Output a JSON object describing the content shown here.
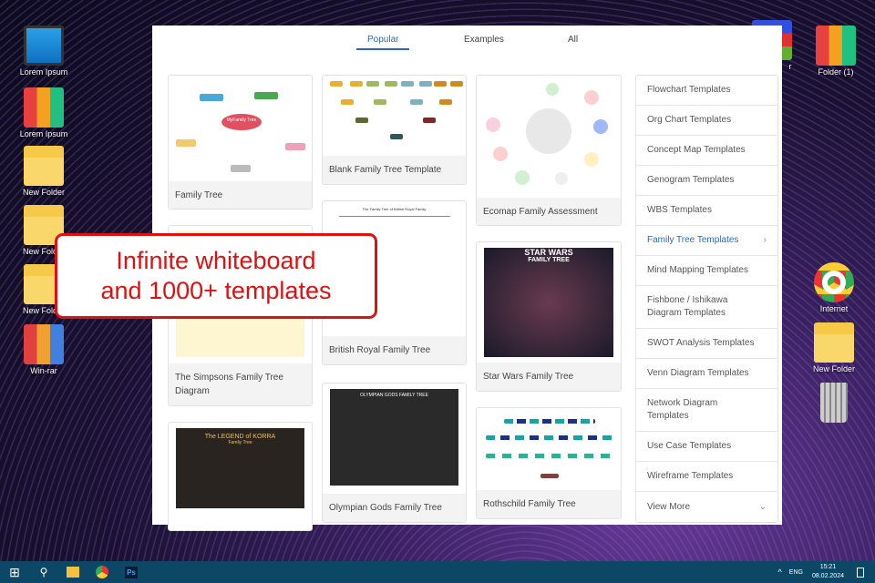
{
  "desktop": {
    "left_icons": [
      "Lorem Ipsum",
      "Lorem Ipsum",
      "New Folder",
      "New Folder",
      "New Folder",
      "Win-rar"
    ],
    "right_icons": [
      "Folder (1)",
      "Internet",
      "New Folder"
    ],
    "partial_label": "r"
  },
  "tabs": [
    {
      "label": "Popular",
      "active": true
    },
    {
      "label": "Examples"
    },
    {
      "label": "All"
    }
  ],
  "cards": {
    "family_tree": "Family Tree",
    "simpsons": "The Simpsons Family Tree Diagram",
    "blank": "Blank Family Tree Template",
    "british": "British Royal Family Tree",
    "olympian": "Olympian Gods Family Tree",
    "ecomap": "Ecomap Family Assessment",
    "starwars": "Star Wars Family Tree",
    "rothschild": "Rothschild Family Tree"
  },
  "thumb_text": {
    "myfamily": "MyFamily Tree",
    "british_title": "The Family Tree of British Royal Family",
    "olympian_title": "OLYMPIAN GODS FAMILY TREE",
    "starwars_logo": "STAR WARS",
    "starwars_sub": "FAMILY TREE",
    "korra": "The LEGEND of KORRA",
    "korra_sub": "Family Tree"
  },
  "categories": [
    "Flowchart Templates",
    "Org Chart Templates",
    "Concept Map Templates",
    "Genogram Templates",
    "WBS Templates",
    "Family Tree Templates",
    "Mind Mapping Templates",
    "Fishbone / Ishikawa Diagram Templates",
    "SWOT Analysis Templates",
    "Venn Diagram Templates",
    "Network Diagram Templates",
    "Use Case Templates",
    "Wireframe Templates",
    "View More"
  ],
  "callout": {
    "line1": "Infinite whiteboard",
    "line2": "and 1000+ templates"
  },
  "taskbar": {
    "lang": "ENG",
    "time": "15:21",
    "date": "08.02.2024",
    "ps": "Ps"
  },
  "colors": {
    "accent": "#2a6ab0",
    "callout": "#e01010",
    "taskbar": "#0c4866"
  }
}
